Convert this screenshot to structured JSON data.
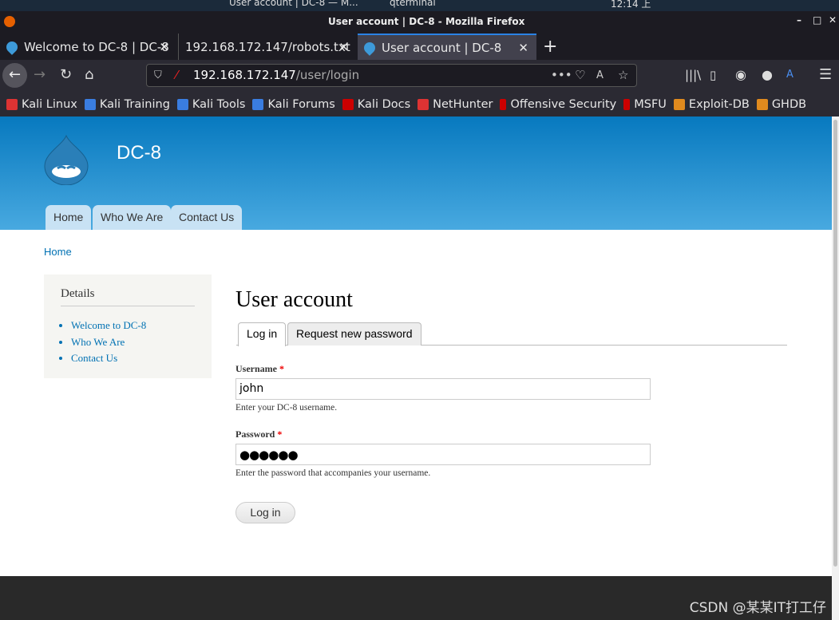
{
  "os_panel": {
    "window_task": "User account | DC-8 — M...",
    "terminal_task": "qterminal",
    "clock": "12:14 上"
  },
  "window": {
    "title": "User account | DC-8 - Mozilla Firefox"
  },
  "tabs": [
    {
      "label": "Welcome to DC-8 | DC-8",
      "active": false
    },
    {
      "label": "192.168.172.147/robots.txt",
      "active": false
    },
    {
      "label": "User account | DC-8",
      "active": true
    }
  ],
  "url": {
    "host": "192.168.172.147",
    "path": "/user/login"
  },
  "bookmarks": [
    {
      "label": "Kali Linux",
      "color": "#d33"
    },
    {
      "label": "Kali Training",
      "color": "#3a7de0"
    },
    {
      "label": "Kali Tools",
      "color": "#3a7de0"
    },
    {
      "label": "Kali Forums",
      "color": "#3a7de0"
    },
    {
      "label": "Kali Docs",
      "color": "#c00"
    },
    {
      "label": "NetHunter",
      "color": "#d33"
    },
    {
      "label": "Offensive Security",
      "color": "#c00"
    },
    {
      "label": "MSFU",
      "color": "#c00"
    },
    {
      "label": "Exploit-DB",
      "color": "#e08a1e"
    },
    {
      "label": "GHDB",
      "color": "#e08a1e"
    }
  ],
  "site": {
    "name": "DC-8",
    "primary_nav": [
      "Home",
      "Who We Are",
      "Contact Us"
    ],
    "breadcrumb": "Home"
  },
  "sidebar": {
    "title": "Details",
    "links": [
      "Welcome to DC-8",
      "Who We Are",
      "Contact Us"
    ]
  },
  "main": {
    "title": "User account",
    "tabs": [
      "Log in",
      "Request new password"
    ],
    "username": {
      "label": "Username",
      "required": "*",
      "value": "john",
      "description": "Enter your DC-8 username."
    },
    "password": {
      "label": "Password",
      "required": "*",
      "value": "●●●●●●",
      "description": "Enter the password that accompanies your username."
    },
    "submit": "Log in"
  },
  "watermark": "CSDN @某某IT打工仔",
  "colors": {
    "header_top": "#0779bf",
    "link": "#0071b3",
    "tab_accent": "#2a82e4"
  }
}
